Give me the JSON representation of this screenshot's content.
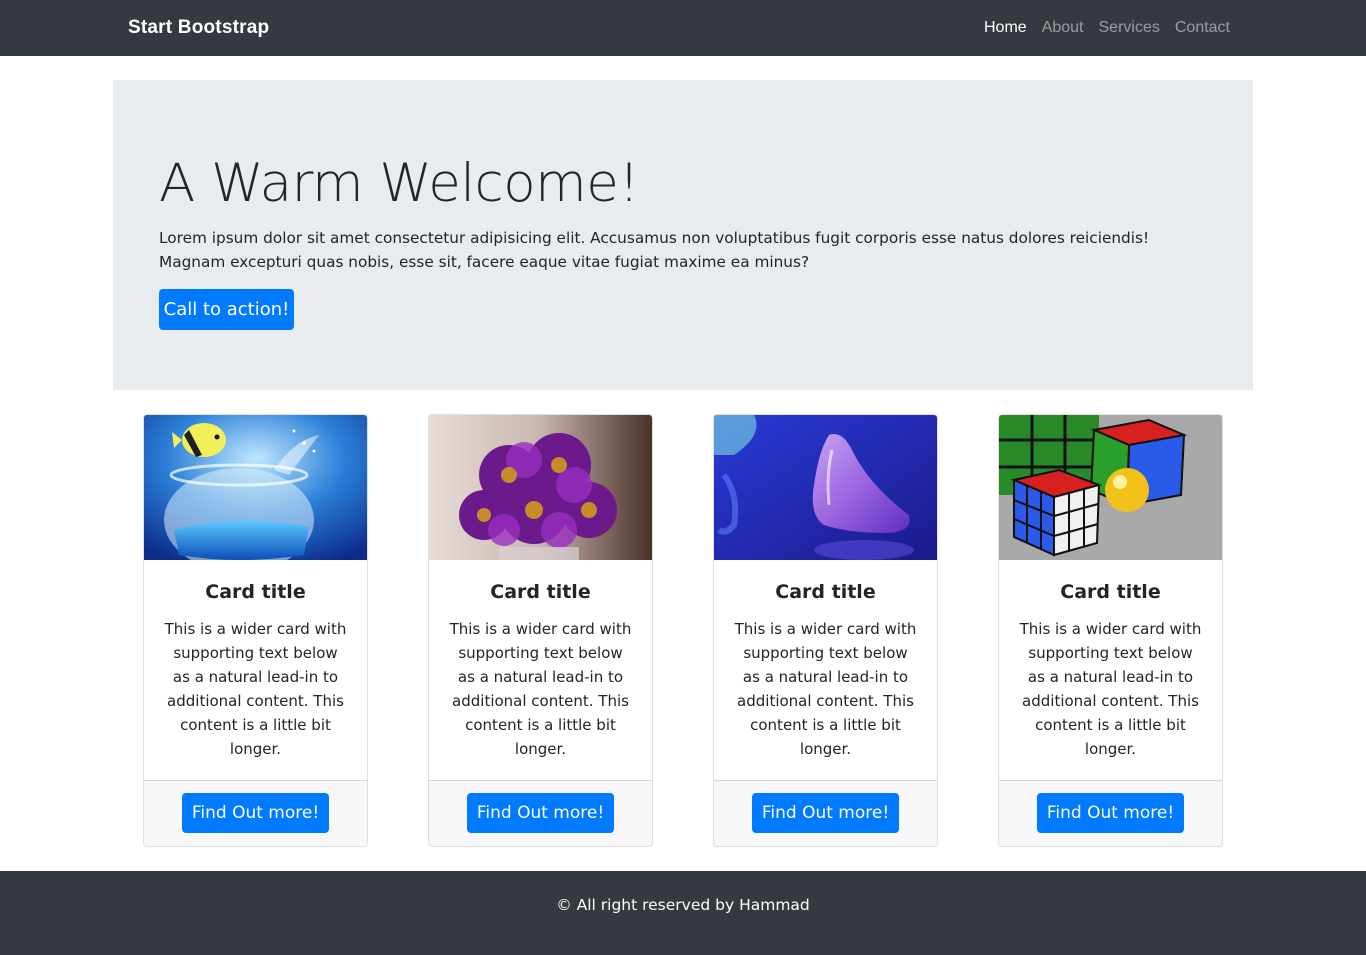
{
  "navbar": {
    "brand": "Start Bootstrap",
    "links": [
      {
        "label": "Home",
        "active": true
      },
      {
        "label": "About",
        "active": false
      },
      {
        "label": "Services",
        "active": false
      },
      {
        "label": "Contact",
        "active": false
      }
    ]
  },
  "hero": {
    "title": "A Warm Welcome!",
    "text": "Lorem ipsum dolor sit amet consectetur adipisicing elit. Accusamus non voluptatibus fugit corporis esse natus dolores reiciendis! Magnam excepturi quas nobis, esse sit, facere eaque vitae fugiat maxime ea minus?",
    "button": "Call to action!"
  },
  "cards": [
    {
      "image": "fishbowl-image",
      "title": "Card title",
      "text": "This is a wider card with supporting text below as a natural lead-in to additional content. This content is a little bit longer.",
      "button": "Find Out more!"
    },
    {
      "image": "purple-flowers-image",
      "title": "Card title",
      "text": "This is a wider card with supporting text below as a natural lead-in to additional content. This content is a little bit longer.",
      "button": "Find Out more!"
    },
    {
      "image": "glass-drop-image",
      "title": "Card title",
      "text": "This is a wider card with supporting text below as a natural lead-in to additional content. This content is a little bit longer.",
      "button": "Find Out more!"
    },
    {
      "image": "rubiks-cubes-image",
      "title": "Card title",
      "text": "This is a wider card with supporting text below as a natural lead-in to additional content. This content is a little bit longer.",
      "button": "Find Out more!"
    }
  ],
  "footer": {
    "text": "© All right reserved by Hammad"
  },
  "colors": {
    "navbar_bg": "#343a40",
    "jumbotron_bg": "#e9ecef",
    "primary": "#007bff",
    "card_footer_bg": "#f7f7f7"
  }
}
